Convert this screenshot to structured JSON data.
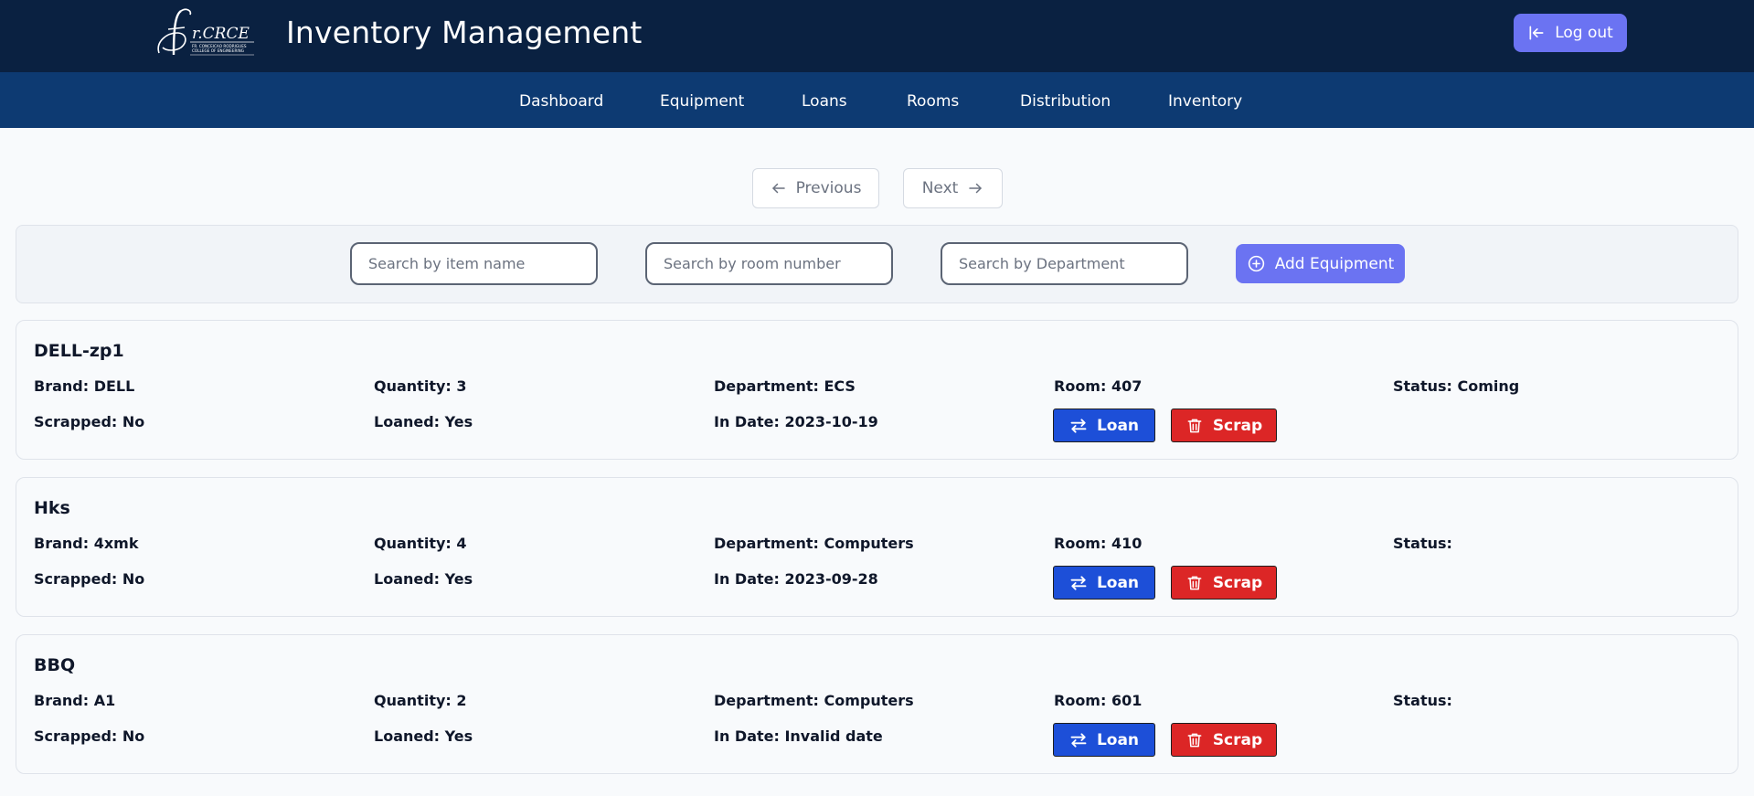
{
  "header": {
    "logo_name": "fr-crce-logo-icon",
    "logo_text": "fr.CRCE",
    "logo_subtext": "FR. CONCEICAO RODRIGUES COLLEGE OF ENGINEERING",
    "title": "Inventory Management",
    "logout_label": "Log out"
  },
  "nav": {
    "items": [
      "Dashboard",
      "Equipment",
      "Loans",
      "Rooms",
      "Distribution",
      "Inventory"
    ]
  },
  "pagination": {
    "previous_label": "Previous",
    "next_label": "Next"
  },
  "search": {
    "item_placeholder": "Search by item name",
    "room_placeholder": "Search by room number",
    "department_placeholder": "Search by Department",
    "item_value": "",
    "room_value": "",
    "department_value": "",
    "add_label": "Add Equipment"
  },
  "items": [
    {
      "name": "DELL-zp1",
      "brand": "Brand: DELL",
      "quantity": "Quantity: 3",
      "department": "Department: ECS",
      "room": "Room: 407",
      "status": "Status: Coming",
      "scrapped": "Scrapped: No",
      "loaned": "Loaned: Yes",
      "in_date": "In Date: 2023-10-19",
      "loan_label": "Loan",
      "scrap_label": "Scrap"
    },
    {
      "name": "Hks",
      "brand": "Brand: 4xmk",
      "quantity": "Quantity: 4",
      "department": "Department: Computers",
      "room": "Room: 410",
      "status": "Status:",
      "scrapped": "Scrapped: No",
      "loaned": "Loaned: Yes",
      "in_date": "In Date: 2023-09-28",
      "loan_label": "Loan",
      "scrap_label": "Scrap"
    },
    {
      "name": "BBQ",
      "brand": "Brand: A1",
      "quantity": "Quantity: 2",
      "department": "Department: Computers",
      "room": "Room: 601",
      "status": "Status:",
      "scrapped": "Scrapped: No",
      "loaned": "Loaned: Yes",
      "in_date": "In Date: Invalid date",
      "loan_label": "Loan",
      "scrap_label": "Scrap"
    }
  ],
  "colors": {
    "header_bg": "#0a2141",
    "nav_bg": "#0d3a72",
    "accent": "#6b73f2",
    "loan": "#1d4fd8",
    "scrap": "#dc2626"
  },
  "icons": {
    "logout": "logout-icon",
    "previous": "arrow-left-icon",
    "next": "arrow-right-icon",
    "add": "plus-circle-icon",
    "loan": "swap-arrows-icon",
    "scrap": "trash-icon"
  }
}
